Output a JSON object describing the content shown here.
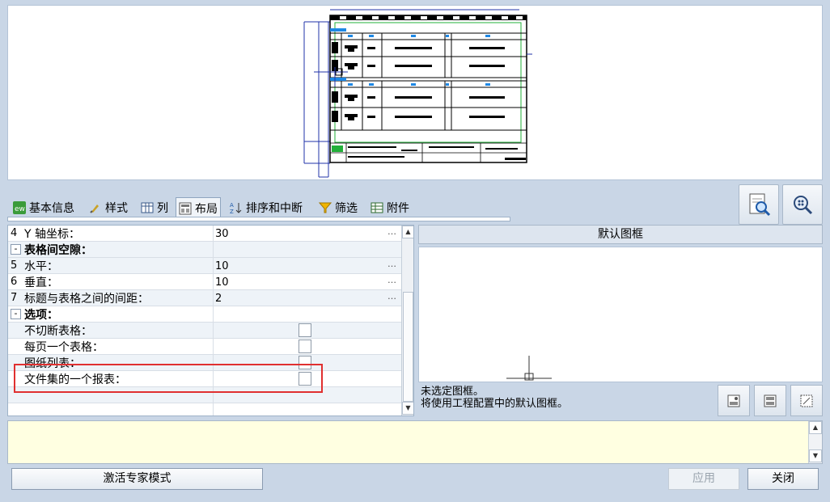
{
  "tabs": [
    {
      "label": "基本信息",
      "icon": "ew-app-icon"
    },
    {
      "label": "样式",
      "icon": "brush-icon"
    },
    {
      "label": "列",
      "icon": "columns-icon"
    },
    {
      "label": "布局",
      "icon": "layout-icon",
      "active": true
    },
    {
      "label": "排序和中断",
      "icon": "sort-az-icon"
    },
    {
      "label": "筛选",
      "icon": "funnel-icon"
    },
    {
      "label": "附件",
      "icon": "attachment-table-icon"
    }
  ],
  "grid": {
    "rows": [
      {
        "num": "4",
        "label": "Y 轴坐标：",
        "value": "30",
        "kind": "value"
      },
      {
        "num": "",
        "label": "表格间空隙：",
        "value": "",
        "kind": "group"
      },
      {
        "num": "5",
        "label": "水平：",
        "value": "10",
        "kind": "value"
      },
      {
        "num": "6",
        "label": "垂直：",
        "value": "10",
        "kind": "value"
      },
      {
        "num": "7",
        "label": "标题与表格之间的间距：",
        "value": "2",
        "kind": "value"
      },
      {
        "num": "",
        "label": "选项：",
        "value": "",
        "kind": "group"
      },
      {
        "num": "",
        "label": "不切断表格：",
        "value": "",
        "kind": "check"
      },
      {
        "num": "",
        "label": "每页一个表格：",
        "value": "",
        "kind": "check"
      },
      {
        "num": "",
        "label": "图纸列表：",
        "value": "",
        "kind": "check"
      },
      {
        "num": "",
        "label": "文件集的一个报表：",
        "value": "",
        "kind": "check"
      }
    ],
    "ellipsis": "…"
  },
  "frame": {
    "header": "默认图框",
    "info_line1": "未选定图框。",
    "info_line2": "将使用工程配置中的默认图框。"
  },
  "buttons": {
    "expert": "激活专家模式",
    "apply": "应用",
    "close": "关闭"
  },
  "colors": {
    "background": "#c9d6e6",
    "highlight": "#e03030",
    "note_bg": "#ffffe1"
  }
}
